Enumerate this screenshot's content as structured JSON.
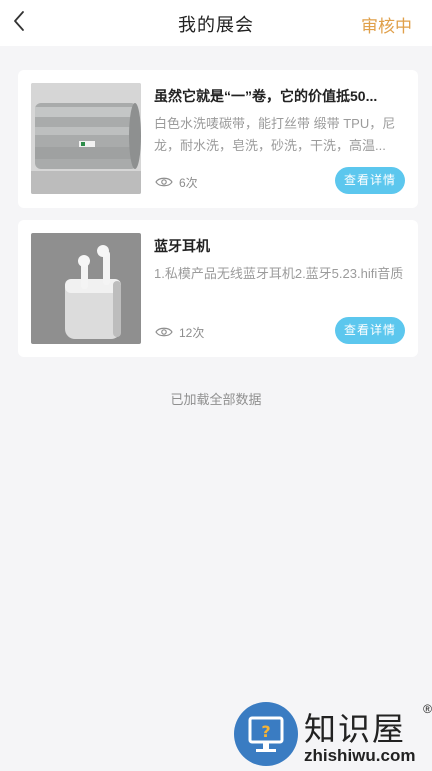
{
  "nav": {
    "title": "我的展会",
    "status": "审核中"
  },
  "items": [
    {
      "title": "虽然它就是“一”卷，它的价值抵50...",
      "description": "白色水洗唛碳带，能打丝带 缎带 TPU，尼龙，耐水洗，皂洗，砂洗，干洗，高温...",
      "views": "6次",
      "button": "查看详情"
    },
    {
      "title": "蓝牙耳机",
      "description": "1.私模产品无线蓝牙耳机2.蓝牙5.23.hifi音质",
      "views": "12次",
      "button": "查看详情"
    }
  ],
  "footer_text": "已加载全部数据",
  "watermark": {
    "brand": "知识屋",
    "reg": "®",
    "url": "zhishiwu.com"
  },
  "colors": {
    "status": "#e0a04a",
    "button": "#5cc7ee",
    "watermark_circle": "#3a7cc2"
  }
}
